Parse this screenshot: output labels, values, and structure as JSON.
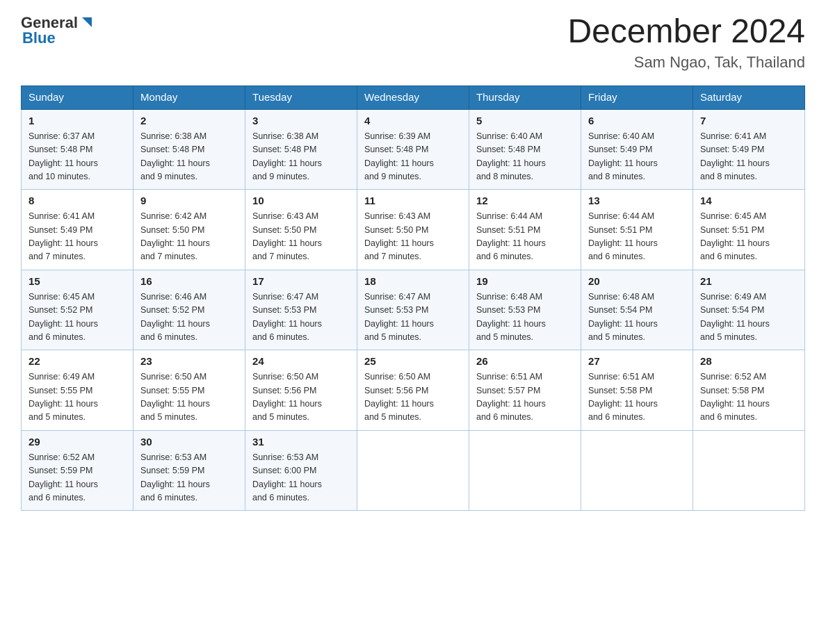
{
  "header": {
    "logo": {
      "general": "General",
      "blue": "Blue"
    },
    "month": "December 2024",
    "location": "Sam Ngao, Tak, Thailand"
  },
  "days_of_week": [
    "Sunday",
    "Monday",
    "Tuesday",
    "Wednesday",
    "Thursday",
    "Friday",
    "Saturday"
  ],
  "weeks": [
    [
      {
        "day": "1",
        "sunrise": "6:37 AM",
        "sunset": "5:48 PM",
        "daylight": "11 hours and 10 minutes."
      },
      {
        "day": "2",
        "sunrise": "6:38 AM",
        "sunset": "5:48 PM",
        "daylight": "11 hours and 9 minutes."
      },
      {
        "day": "3",
        "sunrise": "6:38 AM",
        "sunset": "5:48 PM",
        "daylight": "11 hours and 9 minutes."
      },
      {
        "day": "4",
        "sunrise": "6:39 AM",
        "sunset": "5:48 PM",
        "daylight": "11 hours and 9 minutes."
      },
      {
        "day": "5",
        "sunrise": "6:40 AM",
        "sunset": "5:48 PM",
        "daylight": "11 hours and 8 minutes."
      },
      {
        "day": "6",
        "sunrise": "6:40 AM",
        "sunset": "5:49 PM",
        "daylight": "11 hours and 8 minutes."
      },
      {
        "day": "7",
        "sunrise": "6:41 AM",
        "sunset": "5:49 PM",
        "daylight": "11 hours and 8 minutes."
      }
    ],
    [
      {
        "day": "8",
        "sunrise": "6:41 AM",
        "sunset": "5:49 PM",
        "daylight": "11 hours and 7 minutes."
      },
      {
        "day": "9",
        "sunrise": "6:42 AM",
        "sunset": "5:50 PM",
        "daylight": "11 hours and 7 minutes."
      },
      {
        "day": "10",
        "sunrise": "6:43 AM",
        "sunset": "5:50 PM",
        "daylight": "11 hours and 7 minutes."
      },
      {
        "day": "11",
        "sunrise": "6:43 AM",
        "sunset": "5:50 PM",
        "daylight": "11 hours and 7 minutes."
      },
      {
        "day": "12",
        "sunrise": "6:44 AM",
        "sunset": "5:51 PM",
        "daylight": "11 hours and 6 minutes."
      },
      {
        "day": "13",
        "sunrise": "6:44 AM",
        "sunset": "5:51 PM",
        "daylight": "11 hours and 6 minutes."
      },
      {
        "day": "14",
        "sunrise": "6:45 AM",
        "sunset": "5:51 PM",
        "daylight": "11 hours and 6 minutes."
      }
    ],
    [
      {
        "day": "15",
        "sunrise": "6:45 AM",
        "sunset": "5:52 PM",
        "daylight": "11 hours and 6 minutes."
      },
      {
        "day": "16",
        "sunrise": "6:46 AM",
        "sunset": "5:52 PM",
        "daylight": "11 hours and 6 minutes."
      },
      {
        "day": "17",
        "sunrise": "6:47 AM",
        "sunset": "5:53 PM",
        "daylight": "11 hours and 6 minutes."
      },
      {
        "day": "18",
        "sunrise": "6:47 AM",
        "sunset": "5:53 PM",
        "daylight": "11 hours and 5 minutes."
      },
      {
        "day": "19",
        "sunrise": "6:48 AM",
        "sunset": "5:53 PM",
        "daylight": "11 hours and 5 minutes."
      },
      {
        "day": "20",
        "sunrise": "6:48 AM",
        "sunset": "5:54 PM",
        "daylight": "11 hours and 5 minutes."
      },
      {
        "day": "21",
        "sunrise": "6:49 AM",
        "sunset": "5:54 PM",
        "daylight": "11 hours and 5 minutes."
      }
    ],
    [
      {
        "day": "22",
        "sunrise": "6:49 AM",
        "sunset": "5:55 PM",
        "daylight": "11 hours and 5 minutes."
      },
      {
        "day": "23",
        "sunrise": "6:50 AM",
        "sunset": "5:55 PM",
        "daylight": "11 hours and 5 minutes."
      },
      {
        "day": "24",
        "sunrise": "6:50 AM",
        "sunset": "5:56 PM",
        "daylight": "11 hours and 5 minutes."
      },
      {
        "day": "25",
        "sunrise": "6:50 AM",
        "sunset": "5:56 PM",
        "daylight": "11 hours and 5 minutes."
      },
      {
        "day": "26",
        "sunrise": "6:51 AM",
        "sunset": "5:57 PM",
        "daylight": "11 hours and 6 minutes."
      },
      {
        "day": "27",
        "sunrise": "6:51 AM",
        "sunset": "5:58 PM",
        "daylight": "11 hours and 6 minutes."
      },
      {
        "day": "28",
        "sunrise": "6:52 AM",
        "sunset": "5:58 PM",
        "daylight": "11 hours and 6 minutes."
      }
    ],
    [
      {
        "day": "29",
        "sunrise": "6:52 AM",
        "sunset": "5:59 PM",
        "daylight": "11 hours and 6 minutes."
      },
      {
        "day": "30",
        "sunrise": "6:53 AM",
        "sunset": "5:59 PM",
        "daylight": "11 hours and 6 minutes."
      },
      {
        "day": "31",
        "sunrise": "6:53 AM",
        "sunset": "6:00 PM",
        "daylight": "11 hours and 6 minutes."
      },
      null,
      null,
      null,
      null
    ]
  ],
  "labels": {
    "sunrise": "Sunrise:",
    "sunset": "Sunset:",
    "daylight": "Daylight:"
  }
}
